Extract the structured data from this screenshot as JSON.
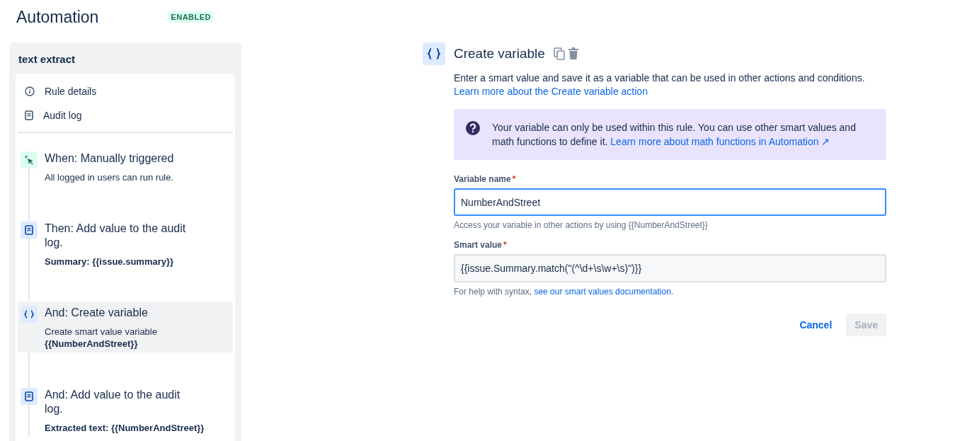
{
  "header": {
    "title": "Automation",
    "status": "ENABLED"
  },
  "sidebar": {
    "rule_name": "text extract",
    "links": [
      {
        "kind": "info",
        "label": "Rule details"
      },
      {
        "kind": "log",
        "label": "Audit log"
      }
    ],
    "steps": [
      {
        "kind": "trigger",
        "title": "When: Manually triggered",
        "selected": false,
        "lines": [
          {
            "text": "All logged in users can run rule.",
            "bold": false
          }
        ]
      },
      {
        "kind": "log",
        "title": "Then: Add value to the audit log.",
        "selected": false,
        "lines": [
          {
            "text": "Summary: {{issue.summary}}",
            "bold": true
          }
        ]
      },
      {
        "kind": "variable",
        "title": "And: Create variable",
        "selected": true,
        "lines": [
          {
            "text": "Create smart value variable",
            "bold": false
          },
          {
            "text": "{{NumberAndStreet}}",
            "bold": true
          }
        ]
      },
      {
        "kind": "log",
        "title": "And: Add value to the audit log.",
        "selected": false,
        "lines": [
          {
            "text": "Extracted text: {{NumberAndStreet}}",
            "bold": true
          }
        ]
      }
    ]
  },
  "panel": {
    "title": "Create variable",
    "description": "Enter a smart value and save it as a variable that can be used in other actions and conditions.",
    "learn_link": "Learn more about the Create variable action",
    "notice": {
      "text": "Your variable can only be used within this rule. You can use other smart values and math functions to define it.",
      "link": "Learn more about math functions in Automation ↗"
    },
    "fields": [
      {
        "label": "Variable name",
        "marker": "*",
        "value": "NumberAndStreet",
        "focused": true,
        "help": "Access your variable in other actions by using {{NumberAndStreet}}"
      },
      {
        "label": "Smart value",
        "marker": "*",
        "value": "{{issue.Summary.match(\"(^\\d+\\s\\w+\\s)\")}}",
        "focused": false,
        "help": "For help with syntax,",
        "help_link": "see our smart values documentation."
      }
    ],
    "buttons": [
      {
        "kind": "link",
        "label": "Cancel",
        "disabled": false
      },
      {
        "kind": "primary",
        "label": "Save",
        "disabled": true
      }
    ]
  }
}
